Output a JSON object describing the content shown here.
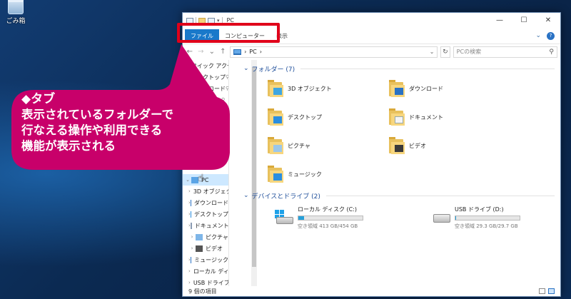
{
  "desktop": {
    "recycle_bin_label": "ごみ箱"
  },
  "window": {
    "title": "PC",
    "quick_access_toolbar": [
      "properties-icon",
      "new-folder-icon",
      "customize-arrow-icon"
    ],
    "controls": {
      "minimize": "—",
      "maximize": "☐",
      "close": "✕"
    }
  },
  "ribbon": {
    "tabs": [
      "ファイル",
      "コンピューター",
      "表示"
    ],
    "active_tab": "ファイル",
    "collapse_icon": "chevron-down-icon",
    "help": "?"
  },
  "address_bar": {
    "back": "←",
    "forward": "→",
    "recent": "⌄",
    "up": "↑",
    "path": [
      "PC"
    ],
    "separator": "›",
    "refresh": "↻",
    "search_placeholder": "PCの検索"
  },
  "nav_pane": {
    "items": [
      {
        "label": "クイック アクセス",
        "icon": "star-icon",
        "level": 0,
        "expand": "⌄"
      },
      {
        "label": "デスクトップ",
        "icon": "desktop-icon",
        "level": 1,
        "pinned": true
      },
      {
        "label": "ダウンロード",
        "icon": "download-icon",
        "level": 1,
        "pinned": true
      },
      {
        "label": "キュメント",
        "icon": "document-icon",
        "level": 1,
        "pinned": true
      },
      {
        "label": "チャ",
        "icon": "pictures-icon",
        "level": 1,
        "pinned": true
      },
      {
        "label": "",
        "icon": "",
        "level": 1
      },
      {
        "label": "ジック",
        "icon": "music-icon",
        "level": 1
      },
      {
        "label": "",
        "icon": "",
        "level": 1
      },
      {
        "label": "eDrive",
        "icon": "onedrive-icon",
        "level": 0
      },
      {
        "label": "",
        "icon": "",
        "level": 0
      },
      {
        "label": "PC",
        "icon": "pc-icon",
        "level": 0,
        "expand": "⌄",
        "selected": true
      },
      {
        "label": "3D オブジェクト",
        "icon": "3d-objects-icon",
        "level": 1,
        "expand": "›"
      },
      {
        "label": "ダウンロード",
        "icon": "download-icon",
        "level": 1,
        "expand": "›"
      },
      {
        "label": "デスクトップ",
        "icon": "desktop-icon",
        "level": 1,
        "expand": "›"
      },
      {
        "label": "ドキュメント",
        "icon": "document-icon",
        "level": 1,
        "expand": "›"
      },
      {
        "label": "ピクチャ",
        "icon": "pictures-icon",
        "level": 1,
        "expand": "›"
      },
      {
        "label": "ビデオ",
        "icon": "video-icon",
        "level": 1,
        "expand": "›"
      },
      {
        "label": "ミュージック",
        "icon": "music-icon",
        "level": 1,
        "expand": "›"
      },
      {
        "label": "ローカル ディスク (C",
        "icon": "drive-c-icon",
        "level": 1,
        "expand": "›"
      },
      {
        "label": "USB ドライブ (D:)",
        "icon": "usb-drive-icon",
        "level": 1,
        "expand": "›"
      }
    ]
  },
  "content": {
    "folders_group": "フォルダー (7)",
    "folders": [
      {
        "label": "3D オブジェクト",
        "icon": "3d-objects-icon"
      },
      {
        "label": "ダウンロード",
        "icon": "download-icon"
      },
      {
        "label": "デスクトップ",
        "icon": "desktop-icon"
      },
      {
        "label": "ドキュメント",
        "icon": "document-icon"
      },
      {
        "label": "ピクチャ",
        "icon": "pictures-icon"
      },
      {
        "label": "ビデオ",
        "icon": "video-icon"
      },
      {
        "label": "ミュージック",
        "icon": "music-icon"
      }
    ],
    "drives_group": "デバイスとドライブ (2)",
    "drives": [
      {
        "label": "ローカル ディスク (C:)",
        "space": "空き領域 413 GB/454 GB",
        "used_fraction": 0.09,
        "icon": "windows-drive-icon"
      },
      {
        "label": "USB ドライブ (D:)",
        "space": "空き領域 29.3 GB/29.7 GB",
        "used_fraction": 0.013,
        "icon": "usb-drive-icon"
      }
    ]
  },
  "status_bar": {
    "text": "9 個の項目"
  },
  "callout": {
    "title": "◆タブ",
    "lines": [
      "表示されているフォルダーで",
      "行なえる操作や利用できる",
      "機能が表示される"
    ],
    "color": "#c8006a"
  },
  "colors": {
    "highlight": "#e0001a",
    "file_tab": "#1979ca",
    "accent": "#1e4e9a"
  }
}
